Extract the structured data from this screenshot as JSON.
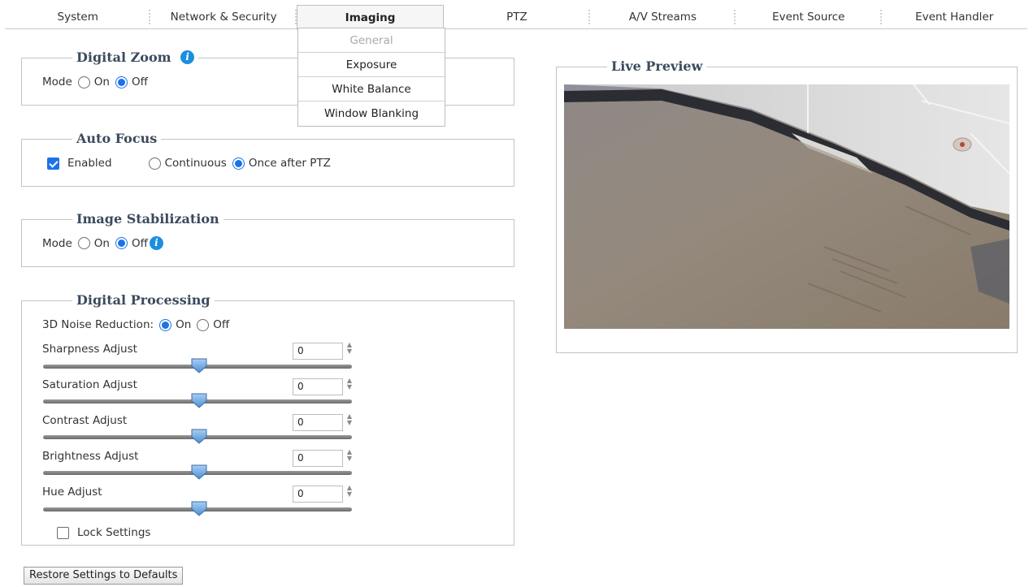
{
  "nav": {
    "tabs": [
      {
        "label": "System"
      },
      {
        "label": "Network & Security"
      },
      {
        "label": "Imaging"
      },
      {
        "label": "PTZ"
      },
      {
        "label": "A/V Streams"
      },
      {
        "label": "Event Source"
      },
      {
        "label": "Event Handler"
      }
    ],
    "active_tab": "Imaging"
  },
  "submenu": {
    "items": [
      {
        "label": "General",
        "disabled": true
      },
      {
        "label": "Exposure"
      },
      {
        "label": "White Balance"
      },
      {
        "label": "Window Blanking"
      }
    ]
  },
  "digital_zoom": {
    "title": "Digital Zoom",
    "mode_label": "Mode",
    "on_label": "On",
    "off_label": "Off",
    "selected": "Off"
  },
  "auto_focus": {
    "title": "Auto Focus",
    "enabled_label": "Enabled",
    "enabled_checked": true,
    "continuous_label": "Continuous",
    "once_label": "Once after PTZ",
    "selected": "Once after PTZ"
  },
  "image_stabilization": {
    "title": "Image Stabilization",
    "mode_label": "Mode",
    "on_label": "On",
    "off_label": "Off",
    "selected": "Off"
  },
  "digital_processing": {
    "title": "Digital Processing",
    "noise_label": "3D Noise Reduction:",
    "on_label": "On",
    "off_label": "Off",
    "noise_selected": "On",
    "sliders": [
      {
        "label": "Sharpness Adjust",
        "value": "0"
      },
      {
        "label": "Saturation Adjust",
        "value": "0"
      },
      {
        "label": "Contrast Adjust",
        "value": "0"
      },
      {
        "label": "Brightness Adjust",
        "value": "0"
      },
      {
        "label": "Hue Adjust",
        "value": "0"
      }
    ],
    "lock_label": "Lock Settings",
    "lock_checked": false
  },
  "live_preview": {
    "title": "Live Preview"
  },
  "restore_button": "Restore Settings to Defaults",
  "colors": {
    "accent": "#1a73e8",
    "legend_text": "#3b4a5e",
    "info_icon": "#1a8fe0"
  }
}
